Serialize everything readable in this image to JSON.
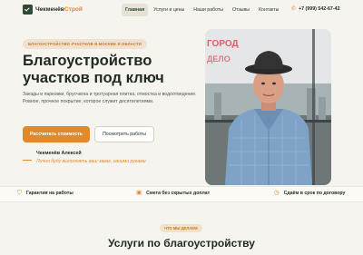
{
  "brand": {
    "name_main": "Чекменёв",
    "name_accent": "Строй"
  },
  "nav": {
    "items": [
      "Главная",
      "Услуги и цены",
      "Наши работы",
      "Отзывы",
      "Контакты"
    ],
    "active": 0
  },
  "phone": "+7 (999) 542-67-42",
  "hero": {
    "badge": "БЛАГОУСТРОЙСТВО УЧАСТКОВ В МОСКВЕ И ОБЛАСТИ",
    "title": "Благоустройство участков под ключ",
    "description": "Заезды и парковки, брусчатка и тротуарная плитка, отмостка и водоотведение. Ровное, прочное покрытие, которое служит десятилетиями.",
    "primary_button": "Рассчитать стоимость",
    "secondary_button": "Посмотреть работы",
    "owner_name": "Чекменёв Алексей",
    "owner_quote": "Лично буду выполнять ваш заказ, своими руками"
  },
  "photo": {
    "sign_text": "ГОРОД ДЕЛО"
  },
  "features": [
    {
      "icon": "shield-icon",
      "label": "Гарантия на работы"
    },
    {
      "icon": "wallet-icon",
      "label": "Смета без скрытых доплат"
    },
    {
      "icon": "clock-icon",
      "label": "Сдаём в срок по договору"
    }
  ],
  "services": {
    "badge": "ЧТО МЫ ДЕЛАЕМ",
    "title": "Услуги по благоустройству"
  },
  "colors": {
    "accent": "#e08a2c",
    "dark": "#2d4a34",
    "background": "#f6f4ee"
  }
}
